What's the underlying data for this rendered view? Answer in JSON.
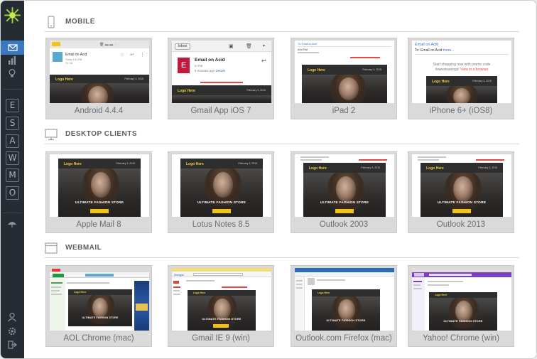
{
  "sidebar": {
    "letters": [
      "E",
      "S",
      "A",
      "W",
      "M",
      "O"
    ]
  },
  "sections": {
    "mobile": "MOBILE",
    "desktop": "DESKTOP CLIENTS",
    "webmail": "WEBMAIL"
  },
  "mobile": [
    {
      "caption": "Android 4.4.4"
    },
    {
      "caption": "Gmail App iOS 7"
    },
    {
      "caption": "iPad 2"
    },
    {
      "caption": "iPhone 6+ (iOS8)"
    }
  ],
  "desktop": [
    {
      "caption": "Apple Mail 8"
    },
    {
      "caption": "Lotus Notes 8.5"
    },
    {
      "caption": "Outlook 2003"
    },
    {
      "caption": "Outlook 2013"
    }
  ],
  "webmail": [
    {
      "caption": "AOL Chrome (mac)"
    },
    {
      "caption": "Gmail IE 9 (win)"
    },
    {
      "caption": "Outlook.com Firefox (mac)"
    },
    {
      "caption": "Yahoo! Chrome (win)"
    }
  ],
  "previews": {
    "sender": "Email on Acid",
    "android_date": "Today 3:04 PM",
    "android_to": "To: me",
    "gmail_inbox": "Inbox",
    "gmail_initial": "E",
    "gmail_to": "to me",
    "gmail_time": "6 minutes ago",
    "gmail_details": "Details",
    "ipad_to": "To: Email on Acid",
    "ipad_subject": "Acid Test",
    "iphone_to_prefix": "To:",
    "iphone_more": "more...",
    "iphone_line1": "Start shopping now with promo code",
    "iphone_line2": "#sweetsavings!",
    "iphone_view": "View in a browser",
    "logo_text": "Logo Here",
    "date_text": "February 3, 2015",
    "store_bold": "ULTIMATE",
    "store_rest": "FASHION STORE"
  },
  "colors": {
    "accent": "#3a78c4",
    "sidebar": "#262c33",
    "button_yellow": "#f2c314",
    "gmail_red": "#c4193d"
  }
}
